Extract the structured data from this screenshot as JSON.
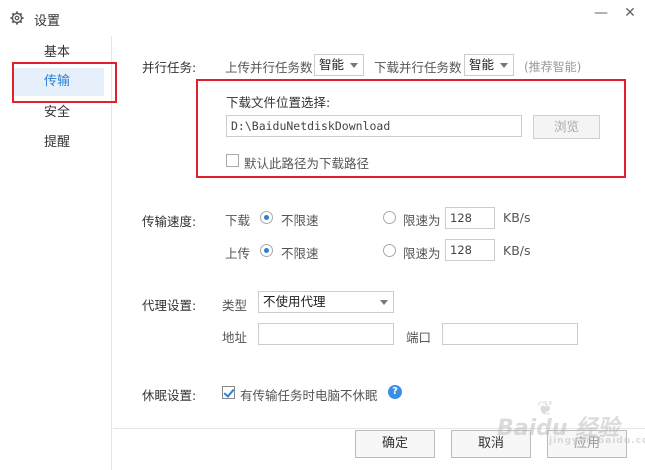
{
  "window": {
    "title": "设置",
    "minimize": "—",
    "close": "✕"
  },
  "sidebar": {
    "items": [
      {
        "label": "基本",
        "active": false
      },
      {
        "label": "传输",
        "active": true
      },
      {
        "label": "安全",
        "active": false
      },
      {
        "label": "提醒",
        "active": false
      }
    ]
  },
  "parallel": {
    "label": "并行任务:",
    "upload_label": "上传并行任务数",
    "upload_value": "智能",
    "download_label": "下载并行任务数",
    "download_value": "智能",
    "hint": "(推荐智能)"
  },
  "download_location": {
    "label": "下载文件位置选择:",
    "path": "D:\\BaiduNetdiskDownload",
    "browse_label": "浏览",
    "default_checkbox_label": "默认此路径为下载路径",
    "default_checked": false
  },
  "speed": {
    "label": "传输速度:",
    "download": {
      "label": "下载",
      "unlimited_label": "不限速",
      "limit_label": "限速为",
      "limit_value": "128",
      "unit": "KB/s",
      "selected": "unlimited"
    },
    "upload": {
      "label": "上传",
      "unlimited_label": "不限速",
      "limit_label": "限速为",
      "limit_value": "128",
      "unit": "KB/s",
      "selected": "unlimited"
    }
  },
  "proxy": {
    "label": "代理设置:",
    "type_label": "类型",
    "type_value": "不使用代理",
    "address_label": "地址",
    "address_value": "",
    "port_label": "端口",
    "port_value": ""
  },
  "sleep": {
    "label": "休眠设置:",
    "checkbox_label": "有传输任务时电脑不休眠",
    "checked": true,
    "help": "?"
  },
  "footer": {
    "ok": "确定",
    "cancel": "取消",
    "apply": "应用"
  },
  "watermark": {
    "paw": "❦",
    "text": "Baidu 经验",
    "sub": "jingyan.baidu.com"
  },
  "colors": {
    "accent": "#2b7fd9",
    "highlight": "#e0202a",
    "active_bg": "#e6f0fb"
  }
}
